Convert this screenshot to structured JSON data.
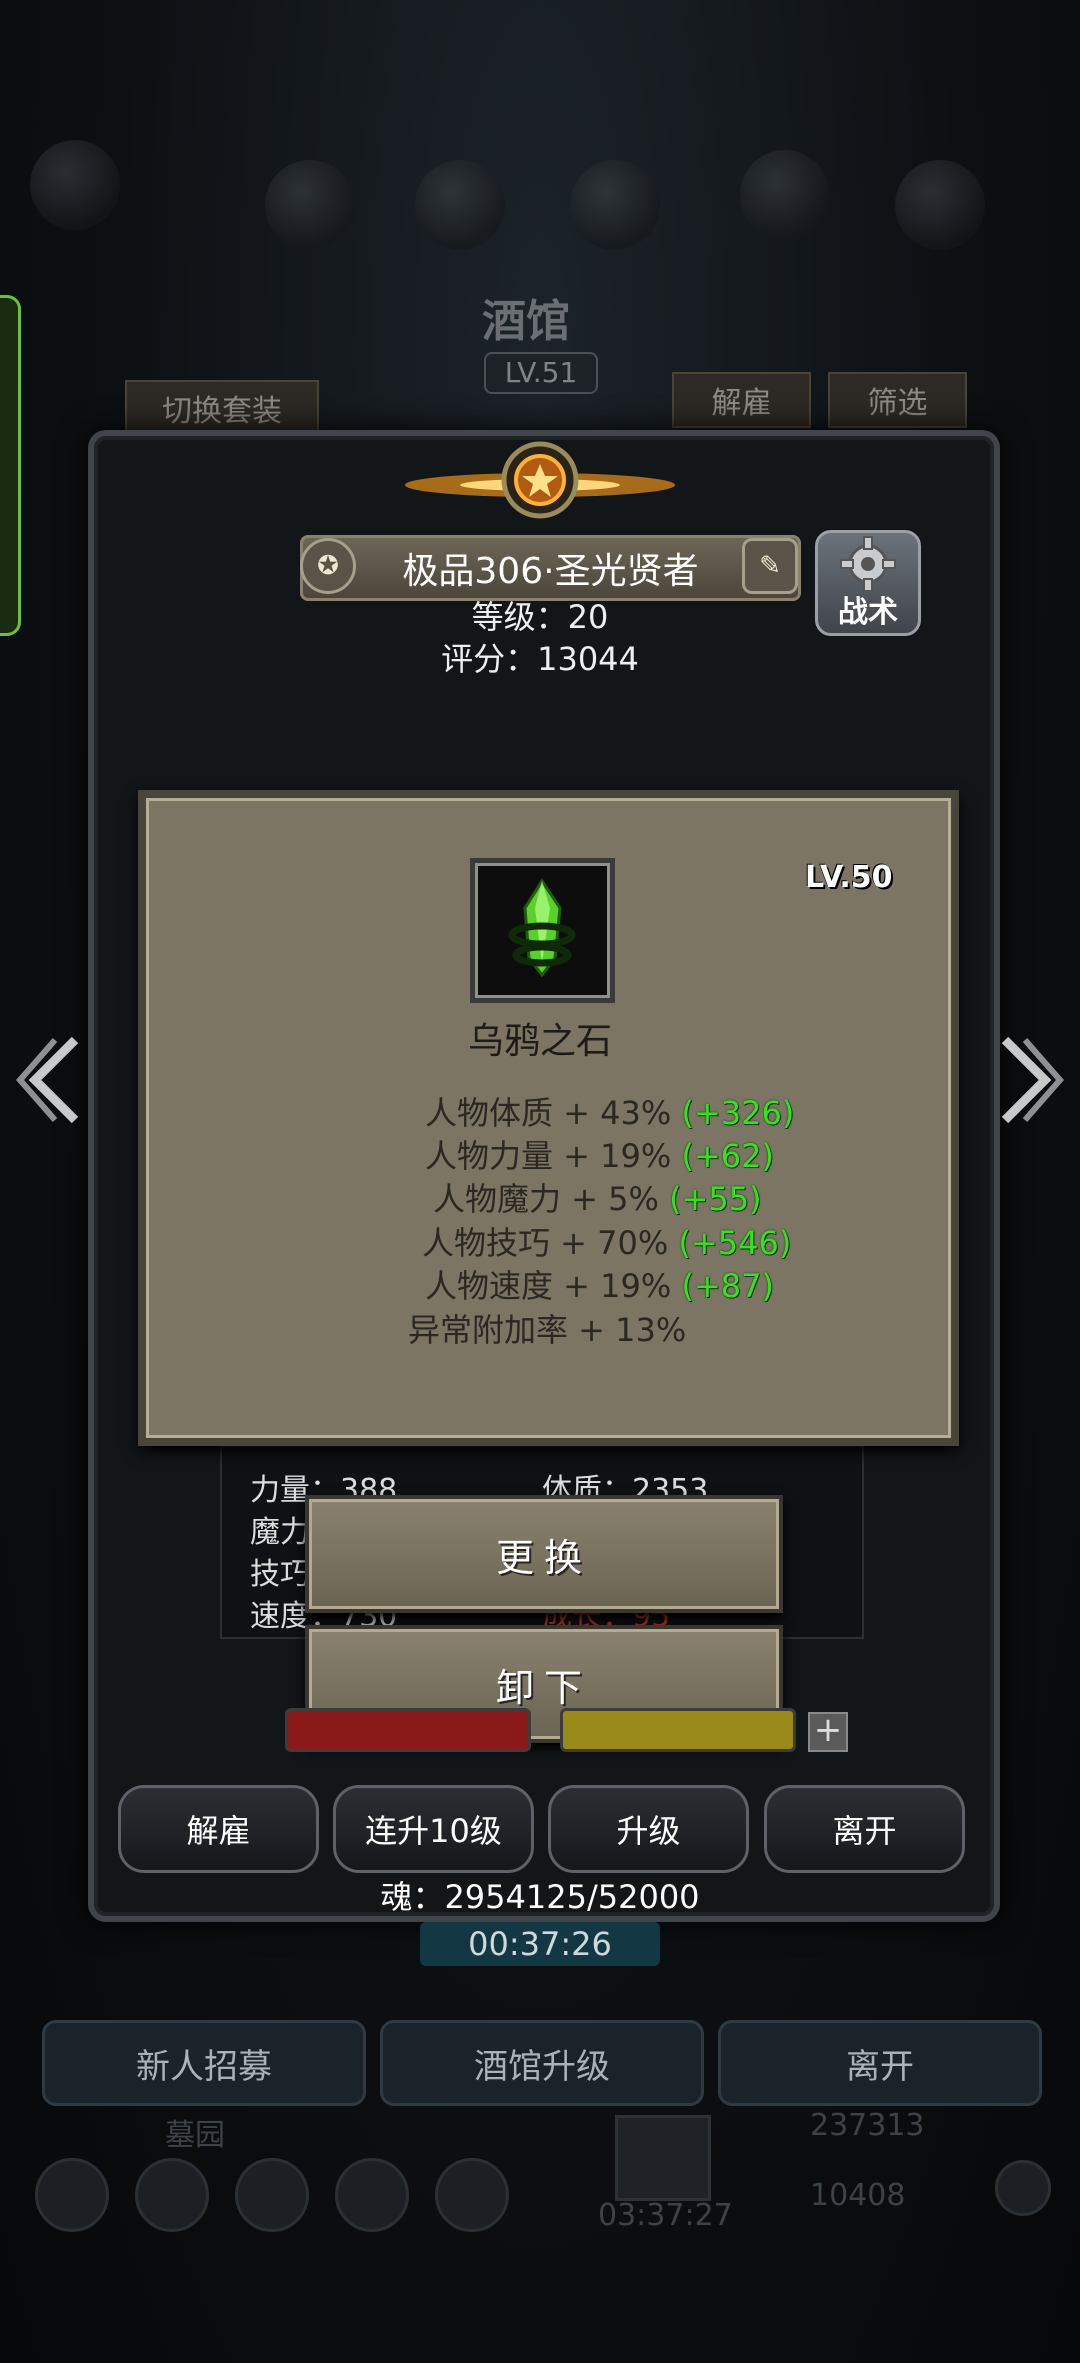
{
  "background": {
    "tavern_title": "酒馆",
    "tavern_level": "LV.51",
    "switch_outfit_label": "切换套装",
    "dismiss_tab_label": "解雇",
    "filter_tab_label": "筛选"
  },
  "hero": {
    "name": "极品306·圣光贤者",
    "level_text": "等级：20",
    "score_text": "评分：13044",
    "tactics_label": "战术"
  },
  "item": {
    "level": "LV.50",
    "name": "乌鸦之石",
    "icon": "green-crystal-stone-icon",
    "stats": [
      {
        "label": "人物体质 + 43%",
        "bonus": "(+326)"
      },
      {
        "label": "人物力量 + 19%",
        "bonus": "(+62)"
      },
      {
        "label": "人物魔力 + 5%",
        "bonus": "(+55)"
      },
      {
        "label": "人物技巧 + 70%",
        "bonus": "(+546)"
      },
      {
        "label": "人物速度 + 19%",
        "bonus": "(+87)"
      },
      {
        "label": "异常附加率 + 13%",
        "bonus": ""
      }
    ]
  },
  "char_stats": {
    "strength": "力量：388",
    "constitution": "体质：2353",
    "magic": "魔力",
    "skill": "技巧",
    "speed": "速度：730",
    "growth": "成长：95"
  },
  "popup": {
    "replace_label": "更换",
    "unequip_label": "卸下"
  },
  "actions": {
    "dismiss": "解雇",
    "level_up_10": "连升10级",
    "level_up": "升级",
    "leave": "离开"
  },
  "soul_text": "魂：2954125/52000",
  "timer_primary": "00:37:26",
  "bottom": {
    "recruit": "新人招募",
    "tavern_upgrade": "酒馆升级",
    "leave": "离开",
    "graveyard": "墓园",
    "gold": "237313",
    "gems": "10408",
    "timer_secondary": "03:37:27"
  },
  "colors": {
    "bonus_green": "#36e21e",
    "panel_parchment": "#7c7564",
    "frame_steel": "#3f454b"
  }
}
